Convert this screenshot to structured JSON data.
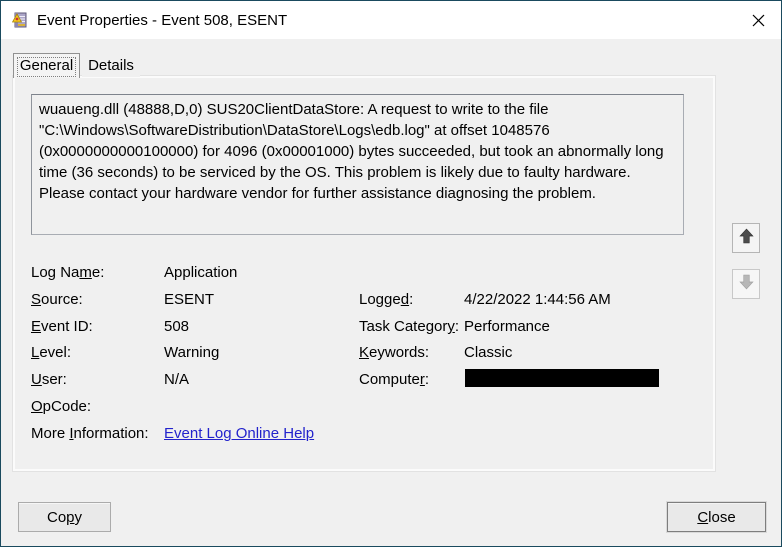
{
  "window": {
    "title": "Event Properties - Event 508, ESENT",
    "border_color": "#1a4a5e",
    "titlebar_bg": "#ffffff",
    "body_bg": "#f0f0f0"
  },
  "icons": {
    "titlebar_icon": "event-log-warning",
    "close_icon": "close-x",
    "scroll_up_icon": "arrow-up",
    "scroll_down_icon": "arrow-down-disabled"
  },
  "tabs": [
    {
      "label": "General",
      "active": true
    },
    {
      "label": "Details",
      "active": false
    }
  ],
  "description": "wuaueng.dll (48888,D,0) SUS20ClientDataStore: A request to write to the file \"C:\\Windows\\SoftwareDistribution\\DataStore\\Logs\\edb.log\" at offset 1048576 (0x0000000000100000) for 4096 (0x00001000) bytes succeeded, but took an abnormally long time (36 seconds) to be serviced by the OS. This problem is likely due to faulty hardware. Please contact your hardware vendor for further assistance diagnosing the problem.",
  "fields": {
    "left": [
      {
        "label_pre": "Log Na",
        "label_key": "m",
        "label_post": "e:",
        "value": "Application"
      },
      {
        "label_pre": "",
        "label_key": "S",
        "label_post": "ource:",
        "value": "ESENT"
      },
      {
        "label_pre": "",
        "label_key": "E",
        "label_post": "vent ID:",
        "value": "508"
      },
      {
        "label_pre": "",
        "label_key": "L",
        "label_post": "evel:",
        "value": "Warning"
      },
      {
        "label_pre": "",
        "label_key": "U",
        "label_post": "ser:",
        "value": "N/A"
      },
      {
        "label_pre": "",
        "label_key": "O",
        "label_post": "pCode:",
        "value": ""
      },
      {
        "label_pre": "More ",
        "label_key": "I",
        "label_post": "nformation:",
        "value": "Event Log Online Help"
      }
    ],
    "right": [
      {
        "label_pre": "Logge",
        "label_key": "d",
        "label_post": ":",
        "value": "4/22/2022 1:44:56 AM"
      },
      {
        "label_pre": "Task Categor",
        "label_key": "y",
        "label_post": ":",
        "value": "Performance"
      },
      {
        "label_pre": "",
        "label_key": "K",
        "label_post": "eywords:",
        "value": "Classic"
      },
      {
        "label_pre": "Compute",
        "label_key": "r",
        "label_post": ":",
        "value": "",
        "redacted": true
      }
    ]
  },
  "link": {
    "color": "#2222cc",
    "text": "Event Log Online Help"
  },
  "buttons": {
    "copy_pre": "Co",
    "copy_key": "p",
    "copy_post": "y",
    "close_pre": "",
    "close_key": "C",
    "close_post": "lose"
  },
  "status_colors": {
    "redaction": "#000000",
    "warning_icon_yellow": "#f5c71a",
    "warning_icon_red": "#c83232"
  }
}
